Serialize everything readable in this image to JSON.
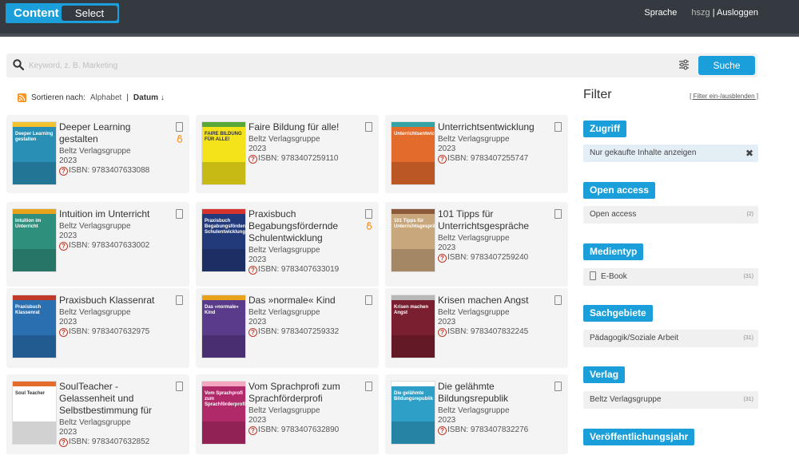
{
  "header": {
    "brand_content": "Content",
    "brand_select": "Select",
    "nav_language": "Sprache",
    "nav_user": "hszg",
    "nav_sep": "|",
    "nav_logout": "Ausloggen"
  },
  "search": {
    "placeholder": "Keyword, z. B. Marketing",
    "button": "Suche"
  },
  "sort": {
    "label": "Sortieren nach:",
    "alphabet": "Alphabet",
    "sep": "|",
    "date": "Datum ↓"
  },
  "books": [
    {
      "title": "Deeper Learning gestalten",
      "publisher": "Beltz Verlagsgruppe",
      "year": "2023",
      "isbn": "ISBN: 9783407633088",
      "oa": true
    },
    {
      "title": "Faire Bildung für alle!",
      "publisher": "Beltz Verlagsgruppe",
      "year": "2023",
      "isbn": "ISBN: 9783407259110",
      "oa": false
    },
    {
      "title": "Unterrichtsentwicklung",
      "publisher": "Beltz Verlagsgruppe",
      "year": "2023",
      "isbn": "ISBN: 9783407255747",
      "oa": false
    },
    {
      "title": "Intuition im Unterricht",
      "publisher": "Beltz Verlagsgruppe",
      "year": "2023",
      "isbn": "ISBN: 9783407633002",
      "oa": false
    },
    {
      "title": "Praxisbuch Begabungsfördernde Schulentwicklung",
      "publisher": "Beltz Verlagsgruppe",
      "year": "2023",
      "isbn": "ISBN: 9783407633019",
      "oa": true
    },
    {
      "title": "101 Tipps für Unterrichtsgespräche",
      "publisher": "Beltz Verlagsgruppe",
      "year": "2023",
      "isbn": "ISBN: 9783407259240",
      "oa": false
    },
    {
      "title": "Praxisbuch Klassenrat",
      "publisher": "Beltz Verlagsgruppe",
      "year": "2023",
      "isbn": "ISBN: 9783407632975",
      "oa": false
    },
    {
      "title": "Das »normale« Kind",
      "publisher": "Beltz Verlagsgruppe",
      "year": "2023",
      "isbn": "ISBN: 9783407259332",
      "oa": false
    },
    {
      "title": "Krisen machen Angst",
      "publisher": "Beltz Verlagsgruppe",
      "year": "2023",
      "isbn": "ISBN: 9783407832245",
      "oa": false
    },
    {
      "title": "SoulTeacher - Gelassenheit und Selbstbestimmung für",
      "publisher": "Beltz Verlagsgruppe",
      "year": "2023",
      "isbn": "ISBN: 9783407632852",
      "oa": false
    },
    {
      "title": "Vom Sprachprofi zum Sprachförderprofi",
      "publisher": "Beltz Verlagsgruppe",
      "year": "2023",
      "isbn": "ISBN: 9783407632890",
      "oa": false
    },
    {
      "title": "Die gelähmte Bildungsrepublik",
      "publisher": "Beltz Verlagsgruppe",
      "year": "2023",
      "isbn": "ISBN: 9783407832276",
      "oa": false
    }
  ],
  "covers": [
    {
      "title": "Deeper Learning gestalten",
      "color": "#2a8fb5",
      "band": "#f2c230"
    },
    {
      "title": "FAIRE BILDUNG FÜR ALLE!",
      "color": "#f4e31a",
      "band": "#5aa637"
    },
    {
      "title": "Unterrichtsentwicklung",
      "color": "#e36b2c",
      "band": "#34a3a3"
    },
    {
      "title": "Intuition im Unterricht",
      "color": "#2f8f7d",
      "band": "#e9a21c"
    },
    {
      "title": "Praxisbuch Begabungsfördernde Schulentwicklung",
      "color": "#223a7a",
      "band": "#d9332f"
    },
    {
      "title": "101 Tipps für Unterrichtsgespräche",
      "color": "#c9a77c",
      "band": "#8a5a3a"
    },
    {
      "title": "Praxisbuch Klassenrat",
      "color": "#2a6fb0",
      "band": "#c0392b"
    },
    {
      "title": "Das »normale« Kind",
      "color": "#5a3a8a",
      "band": "#e9a21c"
    },
    {
      "title": "Krisen machen Angst",
      "color": "#7a1f2f",
      "band": "#b8b8b8"
    },
    {
      "title": "Soul Teacher",
      "color": "#ffffff",
      "band": "#e36b2c"
    },
    {
      "title": "Vom Sprachprofi zum Sprachförderprofi",
      "color": "#b02a6a",
      "band": "#f4a6c0"
    },
    {
      "title": "Die gelähmte Bildungsrepublik",
      "color": "#2ea0c8",
      "band": "#ffffff"
    }
  ],
  "filter": {
    "title": "Filter",
    "toggle": "[ Filter ein-/ausblenden ]",
    "access_head": "Zugriff",
    "access_row": "Nur gekaufte Inhalte anzeigen",
    "access_x": "✖",
    "oa_head": "Open access",
    "oa_row": "Open access",
    "oa_count": "(2)",
    "media_head": "Medientyp",
    "media_row": "E-Book",
    "media_count": "(31)",
    "subject_head": "Sachgebiete",
    "subject_row": "Pädagogik/Soziale Arbeit",
    "subject_count": "(31)",
    "publisher_head": "Verlag",
    "publisher_row": "Beltz Verlagsgruppe",
    "publisher_count": "(31)",
    "year_head": "Veröffentlichungsjahr"
  },
  "colors": {
    "accent": "#1a9fda",
    "topbar": "#343a40",
    "oa": "#f7931e",
    "isbn": "#c0392b"
  }
}
